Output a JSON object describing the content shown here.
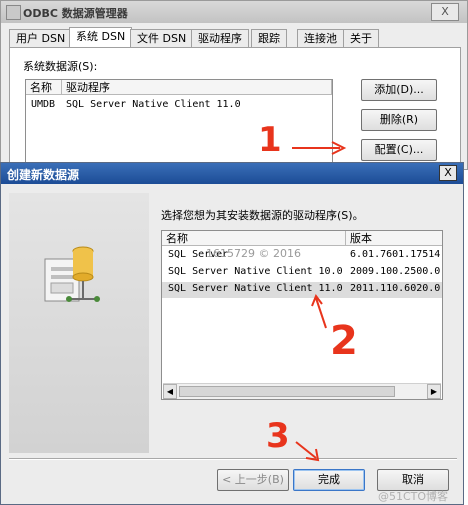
{
  "back_window": {
    "title": "ODBC 数据源管理器",
    "close_label": "X",
    "tabs": [
      "用户 DSN",
      "系统 DSN",
      "文件 DSN",
      "驱动程序",
      "跟踪",
      "连接池",
      "关于"
    ],
    "active_tab": "系统 DSN",
    "section_label": "系统数据源(S):",
    "columns": [
      "名称",
      "驱动程序"
    ],
    "rows": [
      {
        "name": "UMDB",
        "driver": "SQL Server Native Client 11.0"
      }
    ],
    "buttons": {
      "add": "添加(D)...",
      "remove": "删除(R)",
      "configure": "配置(C)..."
    }
  },
  "dialog": {
    "title": "创建新数据源",
    "close_label": "X",
    "prompt": "选择您想为其安装数据源的驱动程序(S)。",
    "columns": [
      "名称",
      "版本"
    ],
    "drivers": [
      {
        "name": "SQL Server",
        "version": "6.01.7601.17514"
      },
      {
        "name": "SQL Server Native Client 10.0",
        "version": "2009.100.2500.0"
      },
      {
        "name": "SQL Server Native Client 11.0",
        "version": "2011.110.6020.0"
      }
    ],
    "selected_driver": "SQL Server Native Client 11.0",
    "watermark": "1615729 © 2016",
    "buttons": {
      "back": "< 上一步(B)",
      "finish": "完成",
      "cancel": "取消"
    }
  },
  "annotations": {
    "step1": "1",
    "step2": "2",
    "step3": "3",
    "arrow_color": "#e8341c"
  },
  "page_watermark": "@51CTO博客"
}
